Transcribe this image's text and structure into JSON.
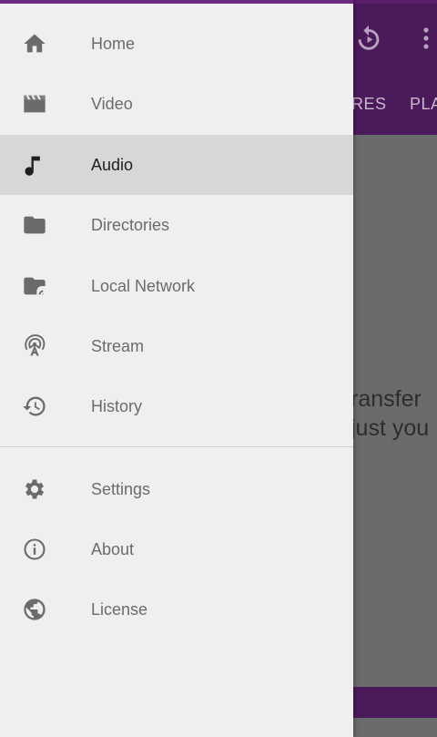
{
  "background": {
    "tabs": [
      "RES",
      "PLA"
    ],
    "content_lines": [
      "ransfer",
      "just you"
    ]
  },
  "drawer": {
    "items": [
      {
        "label": "Home",
        "icon": "home-icon"
      },
      {
        "label": "Video",
        "icon": "video-icon"
      },
      {
        "label": "Audio",
        "icon": "music-note-icon",
        "selected": true
      },
      {
        "label": "Directories",
        "icon": "folder-icon"
      },
      {
        "label": "Local Network",
        "icon": "network-folder-icon"
      },
      {
        "label": "Stream",
        "icon": "broadcast-tower-icon"
      },
      {
        "label": "History",
        "icon": "history-icon"
      }
    ],
    "secondary_items": [
      {
        "label": "Settings",
        "icon": "gear-icon"
      },
      {
        "label": "About",
        "icon": "info-icon"
      },
      {
        "label": "License",
        "icon": "globe-icon"
      }
    ]
  },
  "colors": {
    "accent": "#6a2a7f",
    "drawer_bg": "#efefef",
    "selected_bg": "#d7d7d7",
    "icon": "#6b6b6b",
    "selected_icon": "#1f1f1f"
  }
}
